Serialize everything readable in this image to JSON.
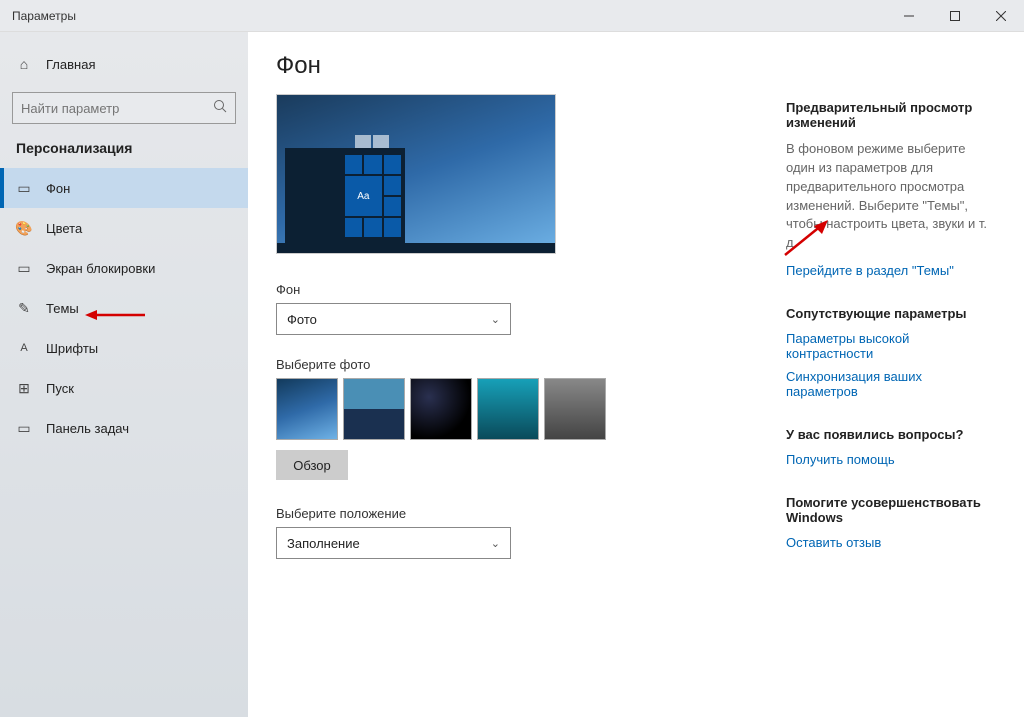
{
  "window": {
    "title": "Параметры"
  },
  "sidebar": {
    "home": "Главная",
    "search_placeholder": "Найти параметр",
    "category": "Персонализация",
    "items": [
      {
        "label": "Фон"
      },
      {
        "label": "Цвета"
      },
      {
        "label": "Экран блокировки"
      },
      {
        "label": "Темы"
      },
      {
        "label": "Шрифты"
      },
      {
        "label": "Пуск"
      },
      {
        "label": "Панель задач"
      }
    ]
  },
  "main": {
    "heading": "Фон",
    "bg_label": "Фон",
    "bg_select_value": "Фото",
    "choose_photo": "Выберите фото",
    "browse": "Обзор",
    "fit_label": "Выберите положение",
    "fit_value": "Заполнение"
  },
  "side": {
    "preview_title": "Предварительный просмотр изменений",
    "preview_text": "В фоновом режиме выберите один из параметров для предварительного просмотра изменений. Выберите \"Темы\", чтобы настроить цвета, звуки и т. д.",
    "themes_link": "Перейдите в раздел \"Темы\"",
    "related_title": "Сопутствующие параметры",
    "related_links": [
      "Параметры высокой контрастности",
      "Синхронизация ваших параметров"
    ],
    "help_title": "У вас появились вопросы?",
    "help_link": "Получить помощь",
    "feedback_title": "Помогите усовершенствовать Windows",
    "feedback_link": "Оставить отзыв"
  }
}
